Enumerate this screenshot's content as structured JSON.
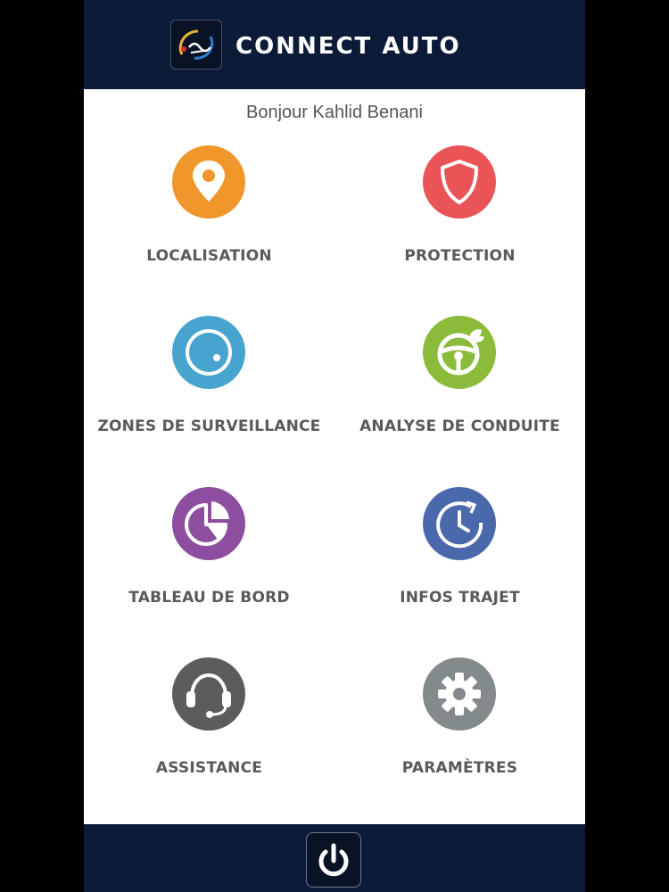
{
  "header": {
    "app_title": "CONNECT AUTO",
    "logo_icon": "connect-auto-logo-icon"
  },
  "greeting": "Bonjour Kahlid Benani",
  "menu": [
    {
      "label": "LOCALISATION",
      "icon": "map-pin-icon",
      "color": "#f0962a"
    },
    {
      "label": "PROTECTION",
      "icon": "shield-icon",
      "color": "#ea5457"
    },
    {
      "label": "ZONES DE SURVEILLANCE",
      "icon": "zone-circle-icon",
      "color": "#46a4cf"
    },
    {
      "label": "ANALYSE DE CONDUITE",
      "icon": "eco-steering-wheel-icon",
      "color": "#8bbb3b"
    },
    {
      "label": "TABLEAU DE BORD",
      "icon": "pie-chart-icon",
      "color": "#8e4e9f"
    },
    {
      "label": "INFOS TRAJET",
      "icon": "clock-refresh-icon",
      "color": "#4a68ac"
    },
    {
      "label": "ASSISTANCE",
      "icon": "headset-icon",
      "color": "#5d5b5c"
    },
    {
      "label": "PARAMÈTRES",
      "icon": "gear-icon",
      "color": "#838a8c"
    }
  ],
  "footer": {
    "power_icon": "power-icon"
  },
  "colors": {
    "bar_background": "#0c1c38",
    "label_text": "#5a5a5a"
  }
}
